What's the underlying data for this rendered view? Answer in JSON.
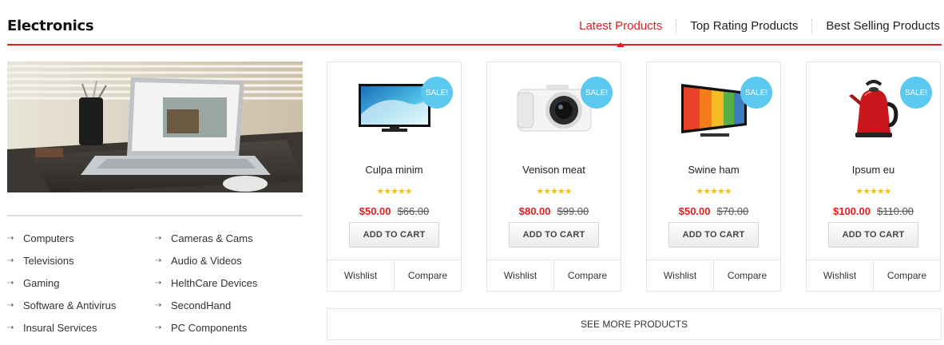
{
  "section": {
    "title": "Electronics"
  },
  "tabs": [
    {
      "label": "Latest Products",
      "active": true
    },
    {
      "label": "Top Rating Products",
      "active": false
    },
    {
      "label": "Best Selling Products",
      "active": false
    }
  ],
  "categories": [
    "Computers",
    "Cameras & Cams",
    "Televisions",
    "Audio & Videos",
    "Gaming",
    "HelthCare Devices",
    "Software & Antivirus",
    "SecondHand",
    "Insural Services",
    "PC Components"
  ],
  "products": [
    {
      "name": "Culpa minim",
      "badge": "SALE!",
      "stars": "★★★★★",
      "price": "$50.00",
      "old_price": "$66.00",
      "image": "television"
    },
    {
      "name": "Venison meat",
      "badge": "SALE!",
      "stars": "★★★★★",
      "price": "$80.00",
      "old_price": "$99.00",
      "image": "camera"
    },
    {
      "name": "Swine ham",
      "badge": "SALE!",
      "stars": "★★★★★",
      "price": "$50.00",
      "old_price": "$70.00",
      "image": "curved-tv"
    },
    {
      "name": "Ipsum eu",
      "badge": "SALE!",
      "stars": "★★★★★",
      "price": "$100.00",
      "old_price": "$110.00",
      "image": "kettle"
    }
  ],
  "labels": {
    "add_to_cart": "ADD TO CART",
    "wishlist": "Wishlist",
    "compare": "Compare",
    "see_more": "SEE MORE PRODUCTS"
  },
  "colors": {
    "accent": "#e31d1d",
    "sale_badge": "#5bc8f0",
    "stars": "#f5c30f"
  }
}
